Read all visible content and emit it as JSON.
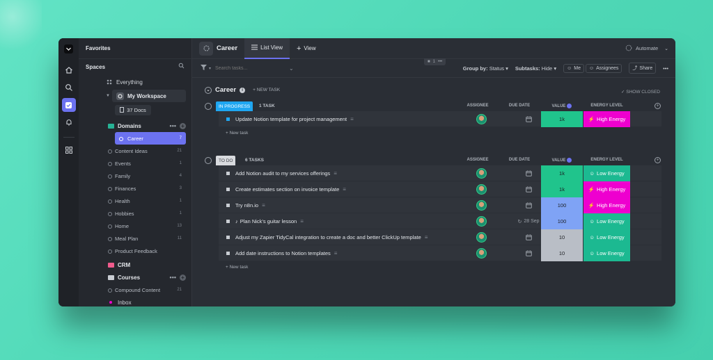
{
  "sidebar": {
    "favorites": "Favorites",
    "spaces": "Spaces",
    "everything": "Everything",
    "workspace": "My Workspace",
    "docs": "37 Docs",
    "domains": "Domains",
    "domain_items": [
      {
        "label": "Career",
        "count": "7"
      },
      {
        "label": "Content Ideas",
        "count": "21"
      },
      {
        "label": "Events",
        "count": "1"
      },
      {
        "label": "Family",
        "count": "4"
      },
      {
        "label": "Finances",
        "count": "3"
      },
      {
        "label": "Health",
        "count": "1"
      },
      {
        "label": "Hobbies",
        "count": "1"
      },
      {
        "label": "Home",
        "count": "13"
      },
      {
        "label": "Meal Plan",
        "count": "11"
      },
      {
        "label": "Product Feedback",
        "count": ""
      }
    ],
    "crm": "CRM",
    "courses": "Courses",
    "course_items": [
      {
        "label": "Compound Content",
        "count": "21"
      }
    ],
    "inbox": "Inbox"
  },
  "topbar": {
    "title": "Career",
    "tab_list": "List View",
    "tab_add": "View",
    "automate": "Automate"
  },
  "toolbar": {
    "search_placeholder": "Search tasks...",
    "page_count": "1",
    "group_by_label": "Group by:",
    "group_by_value": "Status",
    "subtasks_label": "Subtasks:",
    "subtasks_value": "Hide",
    "me": "Me",
    "assignees": "Assignees",
    "share": "Share"
  },
  "list": {
    "title": "Career",
    "new_task": "+ NEW TASK",
    "show_closed": "SHOW CLOSED"
  },
  "columns": {
    "assignee": "ASSIGNEE",
    "due_date": "DUE DATE",
    "value": "VALUE",
    "energy": "ENERGY LEVEL"
  },
  "groups": [
    {
      "status": "IN PROGRESS",
      "count": "1 TASK",
      "color": "#1fa6f1",
      "new_task": "+ New task",
      "tasks": [
        {
          "name": "Update Notion template for project management",
          "due": "",
          "value": "1k",
          "value_color": "#20c48c",
          "energy": "High Energy",
          "energy_color": "#ee00cf",
          "energy_icon": "⚡"
        }
      ]
    },
    {
      "status": "TO DO",
      "count": "6 TASKS",
      "color": "#d8dade",
      "new_task": "+ New task",
      "tasks": [
        {
          "name": "Add Notion audit to my services offerings",
          "due": "",
          "value": "1k",
          "value_color": "#20c48c",
          "energy": "Low Energy",
          "energy_color": "#1cb991",
          "energy_icon": "☺"
        },
        {
          "name": "Create estimates section on invoice template",
          "due": "",
          "value": "1k",
          "value_color": "#20c48c",
          "energy": "High Energy",
          "energy_color": "#ee00cf",
          "energy_icon": "⚡"
        },
        {
          "name": "Try n8n.io",
          "due": "",
          "value": "100",
          "value_color": "#7fa3f5",
          "energy": "High Energy",
          "energy_color": "#ee00cf",
          "energy_icon": "⚡"
        },
        {
          "name": "Plan Nick's guitar lesson",
          "due": "28 Sep",
          "value": "100",
          "value_color": "#7fa3f5",
          "energy": "Low Energy",
          "energy_color": "#1cb991",
          "energy_icon": "☺"
        },
        {
          "name": "Adjust my Zapier TidyCal integration to create a doc and better ClickUp template",
          "due": "",
          "value": "10",
          "value_color": "#b9bec6",
          "energy": "Low Energy",
          "energy_color": "#1cb991",
          "energy_icon": "☺"
        },
        {
          "name": "Add date instructions to Notion templates",
          "due": "",
          "value": "10",
          "value_color": "#b9bec6",
          "energy": "Low Energy",
          "energy_color": "#1cb991",
          "energy_icon": "☺"
        }
      ]
    }
  ]
}
